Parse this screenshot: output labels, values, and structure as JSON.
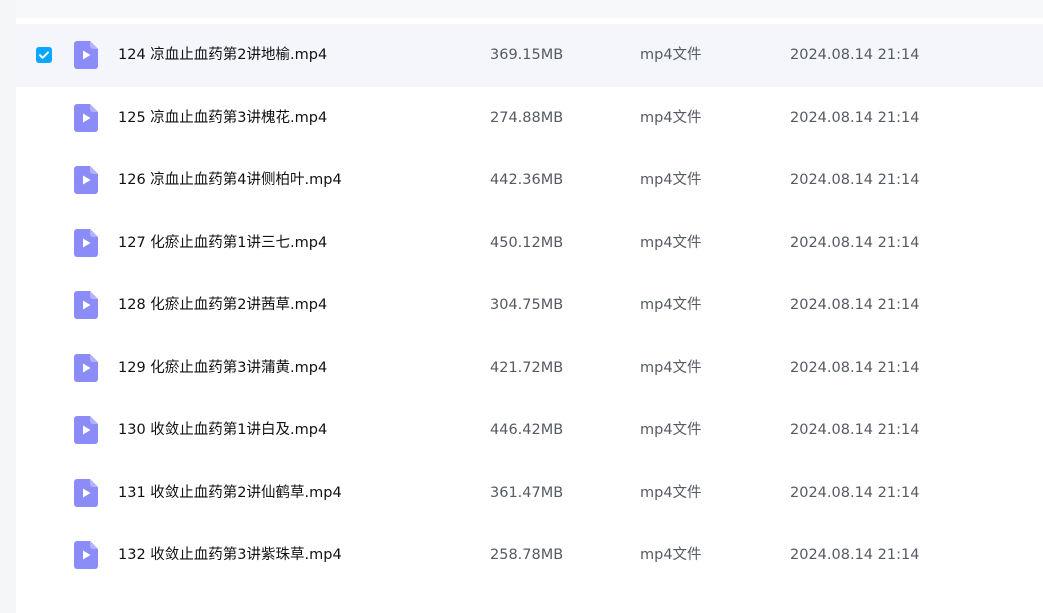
{
  "colors": {
    "accent": "#06a7ff",
    "icon": "#8c8cf8",
    "selected_row": "#f4f6fc"
  },
  "files": [
    {
      "name": "124 凉血止血药第2讲地榆.mp4",
      "size": "369.15MB",
      "type": "mp4文件",
      "date": "2024.08.14 21:14",
      "checked": true,
      "icon": "video-file-icon"
    },
    {
      "name": "125 凉血止血药第3讲槐花.mp4",
      "size": "274.88MB",
      "type": "mp4文件",
      "date": "2024.08.14 21:14",
      "checked": false,
      "icon": "video-file-icon"
    },
    {
      "name": "126 凉血止血药第4讲侧柏叶.mp4",
      "size": "442.36MB",
      "type": "mp4文件",
      "date": "2024.08.14 21:14",
      "checked": false,
      "icon": "video-file-icon"
    },
    {
      "name": "127 化瘀止血药第1讲三七.mp4",
      "size": "450.12MB",
      "type": "mp4文件",
      "date": "2024.08.14 21:14",
      "checked": false,
      "icon": "video-file-icon"
    },
    {
      "name": "128 化瘀止血药第2讲茜草.mp4",
      "size": "304.75MB",
      "type": "mp4文件",
      "date": "2024.08.14 21:14",
      "checked": false,
      "icon": "video-file-icon"
    },
    {
      "name": "129 化瘀止血药第3讲蒲黄.mp4",
      "size": "421.72MB",
      "type": "mp4文件",
      "date": "2024.08.14 21:14",
      "checked": false,
      "icon": "video-file-icon"
    },
    {
      "name": "130 收敛止血药第1讲白及.mp4",
      "size": "446.42MB",
      "type": "mp4文件",
      "date": "2024.08.14 21:14",
      "checked": false,
      "icon": "video-file-icon"
    },
    {
      "name": "131 收敛止血药第2讲仙鹤草.mp4",
      "size": "361.47MB",
      "type": "mp4文件",
      "date": "2024.08.14 21:14",
      "checked": false,
      "icon": "video-file-icon"
    },
    {
      "name": "132 收敛止血药第3讲紫珠草.mp4",
      "size": "258.78MB",
      "type": "mp4文件",
      "date": "2024.08.14 21:14",
      "checked": false,
      "icon": "video-file-icon"
    }
  ]
}
